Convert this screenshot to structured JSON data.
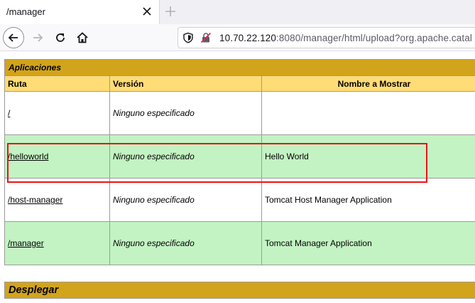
{
  "tab": {
    "title": "/manager"
  },
  "url": {
    "host": "10.70.22.120",
    "rest": ":8080/manager/html/upload?org.apache.catal"
  },
  "applications": {
    "title": "Aplicaciones",
    "headers": {
      "path": "Ruta",
      "version": "Versión",
      "display_name": "Nombre a Mostrar"
    },
    "rows": [
      {
        "path": "/",
        "version": "Ninguno especificado",
        "display_name": ""
      },
      {
        "path": "/helloworld",
        "version": "Ninguno especificado",
        "display_name": "Hello World"
      },
      {
        "path": "/host-manager",
        "version": "Ninguno especificado",
        "display_name": "Tomcat Host Manager Application"
      },
      {
        "path": "/manager",
        "version": "Ninguno especificado",
        "display_name": "Tomcat Manager Application"
      }
    ]
  },
  "deploy": {
    "title": "Desplegar"
  },
  "colors": {
    "section_header": "#d2a41c",
    "column_header": "#ffdc75",
    "row_alt": "#c3f3c3",
    "highlight": "#e8141a"
  }
}
